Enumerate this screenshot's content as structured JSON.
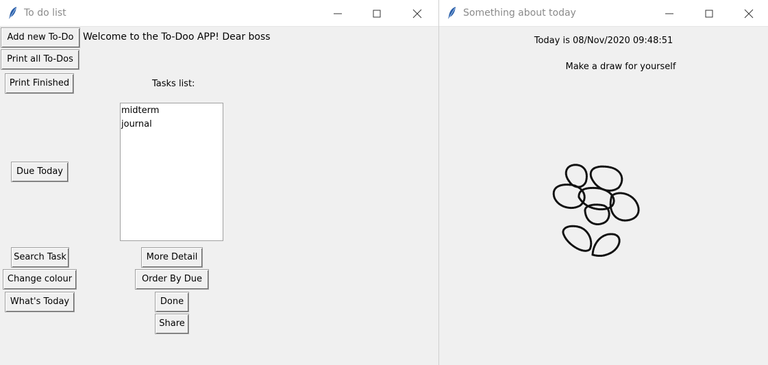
{
  "left_window": {
    "title": "To do list",
    "buttons": {
      "add_new": "Add new To-Do",
      "print_all": "Print all To-Dos",
      "print_finished": "Print Finished",
      "due_today": "Due Today",
      "search_task": "Search Task",
      "change_colour": "Change colour",
      "whats_today": "What's Today",
      "more_detail": "More Detail",
      "order_by_due": "Order By Due",
      "done": "Done",
      "share": "Share"
    },
    "welcome_text": "Welcome to the To-Doo APP! Dear boss",
    "tasks_label": "Tasks list:",
    "tasks": [
      "midterm",
      "journal"
    ]
  },
  "right_window": {
    "title": "Something about today",
    "date_text": "Today is 08/Nov/2020 09:48:51",
    "draw_prompt": "Make a draw for yourself"
  }
}
